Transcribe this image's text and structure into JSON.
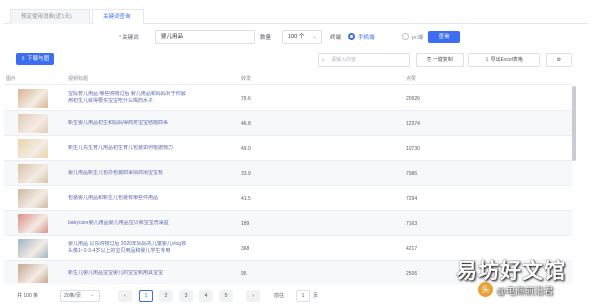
{
  "tabs": [
    {
      "label": "预定使用消费(近1天)"
    },
    {
      "label": "关键词查询"
    }
  ],
  "filters": {
    "keyword_label": "关键词",
    "keyword_value": "婴儿用品",
    "count_label": "数量",
    "count_value": "100 个",
    "platform_label": "终端",
    "platform_options": [
      "手机端",
      "pc端"
    ],
    "query_button": "查询"
  },
  "toolbar": {
    "download_button": "下载与图",
    "search_placeholder": "请输入内容",
    "copy_button": "一键复制",
    "export_button": "导出Excel表格",
    "settings_icon": "gear-icon"
  },
  "table": {
    "headers": [
      "图片",
      "视频标题",
      "转发",
      "点赞"
    ],
    "rows": [
      {
        "title": "宝妈育儿用品 哪些购物过后 婴儿用品和妈妈对于你最用初生儿就得要买宝宝吃什么喝药水子",
        "share": "79.6",
        "likes": "20926",
        "thumb": "#d9b48f"
      },
      {
        "title": "新生婴儿用品初生和妈妈得商务宝宝结婚四事",
        "share": "46.8",
        "likes": "12374",
        "thumb": "#e2c9b4"
      },
      {
        "title": "新生儿先生育儿用品初生育儿包装如何根据物力",
        "share": "49.9",
        "likes": "10730",
        "thumb": "#e9d3a8"
      },
      {
        "title": "婴儿用品新生儿包办包装四事情商场宝宝有",
        "share": "33.9",
        "likes": "7986",
        "thumb": "#d7c2a7"
      },
      {
        "title": "包装婴儿用品和新生儿包装有哪些件用品",
        "share": "41.5",
        "likes": "7294",
        "thumb": "#cdb9a0"
      },
      {
        "title": "babycare婴儿用品婴儿用品宝贝和宝宝洗澡盆",
        "share": "189",
        "likes": "7163",
        "thumb": "#d98f88"
      },
      {
        "title": "婴儿用品 以东购物过后 2020年妈妈先儿童婴儿vlog孩头像1~2-3-4岁以上的宝贝用品和婴儿学生专用",
        "share": "368",
        "likes": "4217",
        "thumb": "#9fb4c4"
      },
      {
        "title": "新生儿婴儿用品宝宝婴儿的宝宝和用具宝宝",
        "share": "95",
        "likes": "2506",
        "thumb": "#c4a990"
      }
    ]
  },
  "footer": {
    "total": "共 100 条",
    "page_size": "20条/页",
    "pages": [
      "1",
      "2",
      "3",
      "4",
      "5"
    ],
    "prev_icon": "chevron-left-icon",
    "next_icon": "chevron-right-icon",
    "goto_label": "前往",
    "goto_value": "1",
    "goto_suffix": "页"
  },
  "watermark": {
    "title": "易坊好文馆",
    "subtitle": "头条 @电商前沿君"
  }
}
